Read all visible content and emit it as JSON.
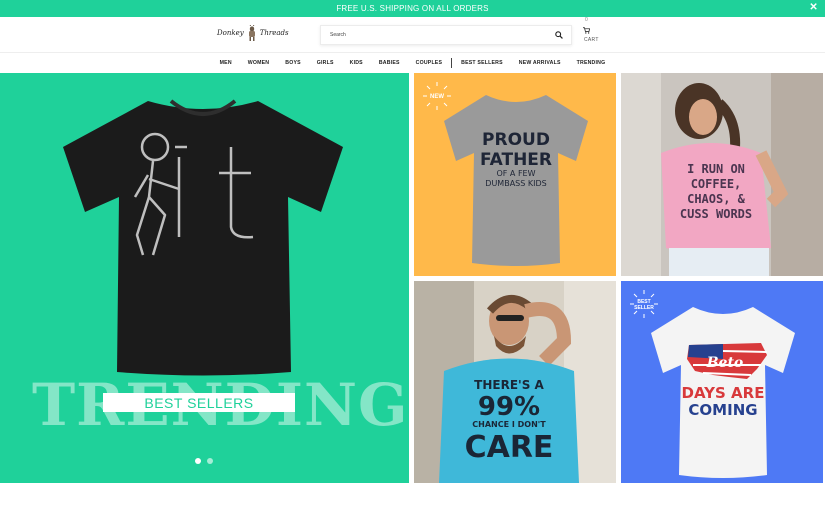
{
  "banner": {
    "text": "FREE U.S. SHIPPING ON ALL ORDERS",
    "close": "✕"
  },
  "logo": {
    "word1": "Donkey",
    "word2": "Threads"
  },
  "search": {
    "placeholder": "Search"
  },
  "cart": {
    "count": "0",
    "label": "CART"
  },
  "nav": {
    "items": [
      "MEN",
      "WOMEN",
      "BOYS",
      "GIRLS",
      "KIDS",
      "BABIES",
      "COUPLES"
    ],
    "items2": [
      "BEST SELLERS",
      "NEW ARRIVALS",
      "TRENDING"
    ]
  },
  "hero": {
    "bg_word": "TRENDING",
    "label": "BEST SELLERS"
  },
  "tiles": {
    "t1": {
      "badge": "NEW",
      "line1": "PROUD",
      "line2": "FATHER",
      "line3": "OF A FEW",
      "line4": "DUMBASS KIDS"
    },
    "t2": {
      "line1": "I RUN ON",
      "line2": "COFFEE,",
      "line3": "CHAOS, &",
      "line4": "CUSS WORDS"
    },
    "t3": {
      "line1": "THERE'S A",
      "line2": "99%",
      "line3": "CHANCE I DON'T",
      "line4": "CARE"
    },
    "t4": {
      "badge1": "BEST",
      "badge2": "SELLER",
      "script": "Beto",
      "line1": "DAYS ARE",
      "line2": "COMING"
    }
  },
  "colors": {
    "accent": "#1fd19a",
    "orange": "#ffb94a",
    "blue": "#4e79f5"
  }
}
